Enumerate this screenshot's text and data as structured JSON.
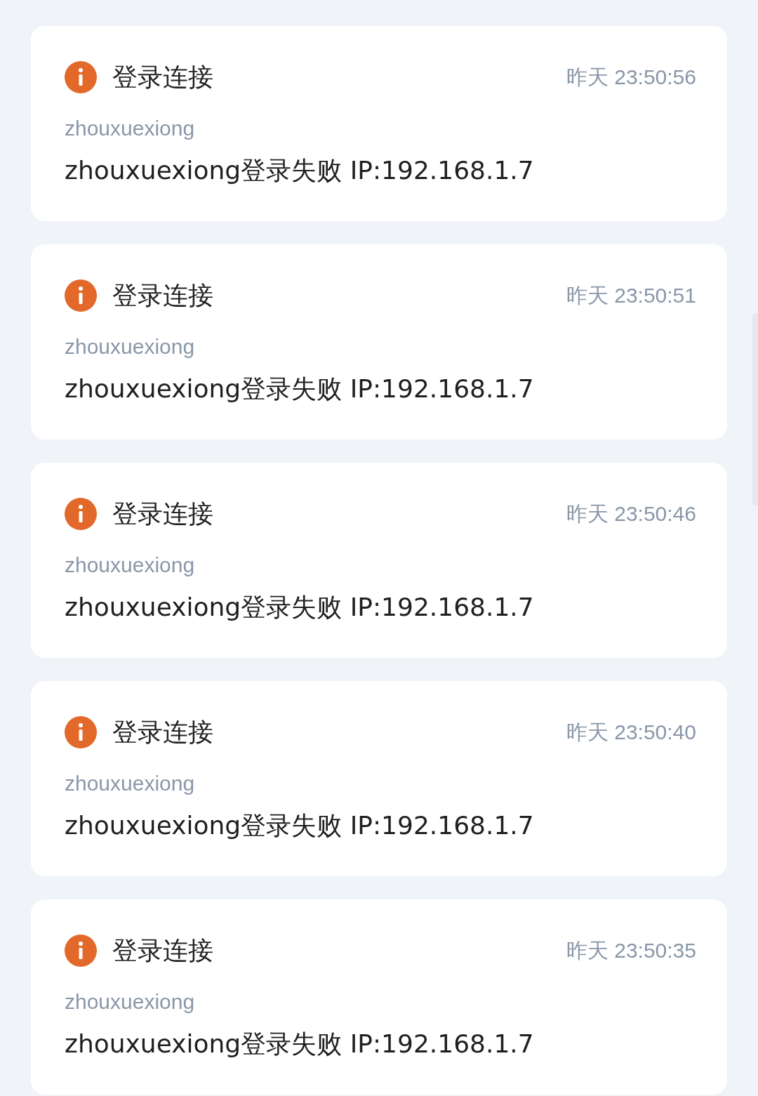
{
  "notifications": [
    {
      "title": "登录连接",
      "time": "昨天 23:50:56",
      "user": "zhouxuexiong",
      "message": "zhouxuexiong登录失败 IP:192.168.1.7"
    },
    {
      "title": "登录连接",
      "time": "昨天 23:50:51",
      "user": "zhouxuexiong",
      "message": "zhouxuexiong登录失败 IP:192.168.1.7"
    },
    {
      "title": "登录连接",
      "time": "昨天 23:50:46",
      "user": "zhouxuexiong",
      "message": "zhouxuexiong登录失败 IP:192.168.1.7"
    },
    {
      "title": "登录连接",
      "time": "昨天 23:50:40",
      "user": "zhouxuexiong",
      "message": "zhouxuexiong登录失败 IP:192.168.1.7"
    },
    {
      "title": "登录连接",
      "time": "昨天 23:50:35",
      "user": "zhouxuexiong",
      "message": "zhouxuexiong登录失败 IP:192.168.1.7"
    }
  ]
}
